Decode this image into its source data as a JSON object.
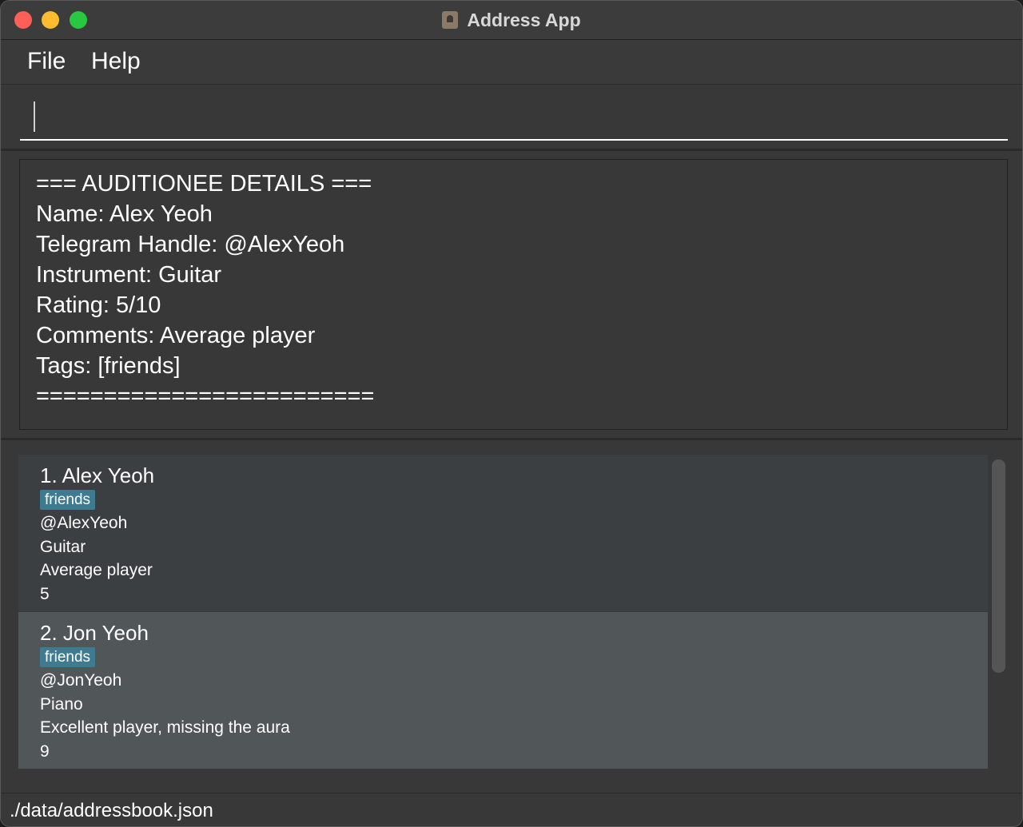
{
  "window": {
    "title": "Address App"
  },
  "menu": {
    "file_label": "File",
    "help_label": "Help"
  },
  "command": {
    "value": "",
    "placeholder": ""
  },
  "result": {
    "lines": [
      "=== AUDITIONEE DETAILS ===",
      "Name: Alex Yeoh",
      "Telegram Handle: @AlexYeoh",
      "Instrument: Guitar",
      "Rating: 5/10",
      "Comments: Average player",
      "Tags: [friends]",
      "========================="
    ]
  },
  "persons": [
    {
      "name": "1. Alex Yeoh",
      "tag": "friends",
      "handle": "@AlexYeoh",
      "instrument": "Guitar",
      "comment": "Average player",
      "rating": "5"
    },
    {
      "name": "2. Jon Yeoh",
      "tag": "friends",
      "handle": "@JonYeoh",
      "instrument": "Piano",
      "comment": "Excellent player, missing the aura",
      "rating": "9"
    }
  ],
  "status": {
    "path": "./data/addressbook.json"
  },
  "colors": {
    "window_bg": "#383838",
    "tag_bg": "#3e7b91",
    "card_odd": "#3c3f41",
    "card_even": "#515658"
  },
  "icons": {
    "app": "address-book-icon"
  }
}
